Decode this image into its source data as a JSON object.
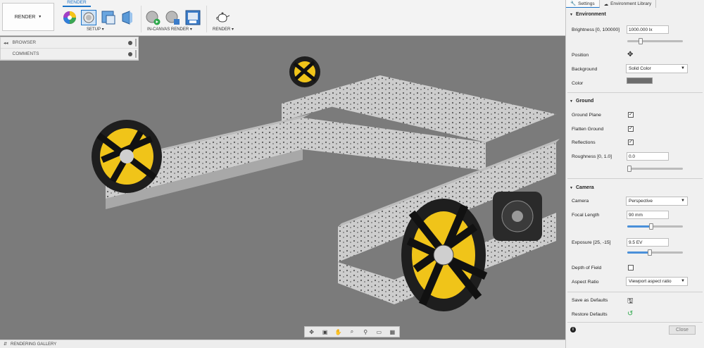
{
  "toolbar": {
    "workspace_label": "RENDER",
    "active_tab": "RENDER",
    "groups": {
      "setup": "SETUP ▾",
      "in_canvas": "IN-CANVAS RENDER ▾",
      "render": "RENDER ▾"
    }
  },
  "browser": {
    "items": [
      {
        "label": "BROWSER"
      },
      {
        "label": "COMMENTS"
      }
    ]
  },
  "gallery": {
    "label": "RENDERING GALLERY"
  },
  "panel": {
    "tabs": [
      "Settings",
      "Environment Library"
    ],
    "environment": {
      "title": "Environment",
      "brightness_label": "Brightness [0, 100000]",
      "brightness_value": "1000.000 lx",
      "brightness_level": 0.22,
      "position_label": "Position",
      "background_label": "Background",
      "background_value": "Solid Color",
      "color_label": "Color",
      "color_hex": "#6d6d6d"
    },
    "ground": {
      "title": "Ground",
      "ground_plane_label": "Ground Plane",
      "flatten_label": "Flatten Ground",
      "reflections_label": "Reflections",
      "roughness_label": "Roughness [0, 1.0]",
      "roughness_value": "0.0",
      "roughness_level": 0.0
    },
    "camera": {
      "title": "Camera",
      "camera_label": "Camera",
      "camera_value": "Perspective",
      "focal_label": "Focal Length",
      "focal_value": "90 mm",
      "focal_level": 0.42,
      "exposure_label": "Exposure [25, -15]",
      "exposure_value": "9.5 EV",
      "exposure_level": 0.39,
      "dof_label": "Depth of Field",
      "aspect_label": "Aspect Ratio",
      "aspect_value": "Viewport aspect ratio"
    },
    "defaults": {
      "save_label": "Save as Defaults",
      "restore_label": "Restore Defaults"
    },
    "close_label": "Close"
  },
  "colors": {
    "accent": "#1b73c7",
    "viewport_bg": "#7b7b7b",
    "wheel_yellow": "#f0c419"
  }
}
